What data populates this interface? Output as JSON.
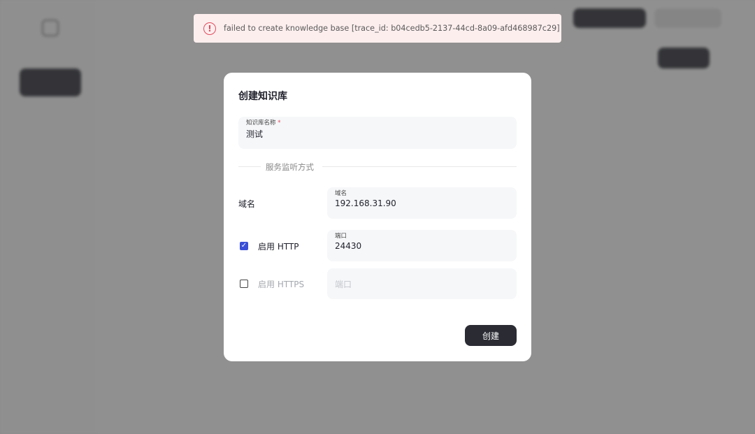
{
  "toast": {
    "icon": "error-circle-icon",
    "color": "#e04b5c",
    "message": "failed to create knowledge base [trace_id: b04cedb5-2137-44cd-8a09-afd468987c29]"
  },
  "modal": {
    "title": "创建知识库",
    "name_field": {
      "label": "知识库名称",
      "required_mark": "*",
      "value": "测试"
    },
    "section_divider": "服务监听方式",
    "domain_row": {
      "label": "域名",
      "field_label": "域名",
      "value": "192.168.31.90"
    },
    "http_row": {
      "checked": true,
      "label": "启用 HTTP",
      "field_label": "端口",
      "value": "24430"
    },
    "https_row": {
      "checked": false,
      "label": "启用 HTTPS",
      "placeholder": "端口"
    },
    "submit_label": "创建"
  },
  "colors": {
    "accent": "#3a4fd6",
    "primary_button": "#2a2b33",
    "error": "#e04b5c"
  }
}
